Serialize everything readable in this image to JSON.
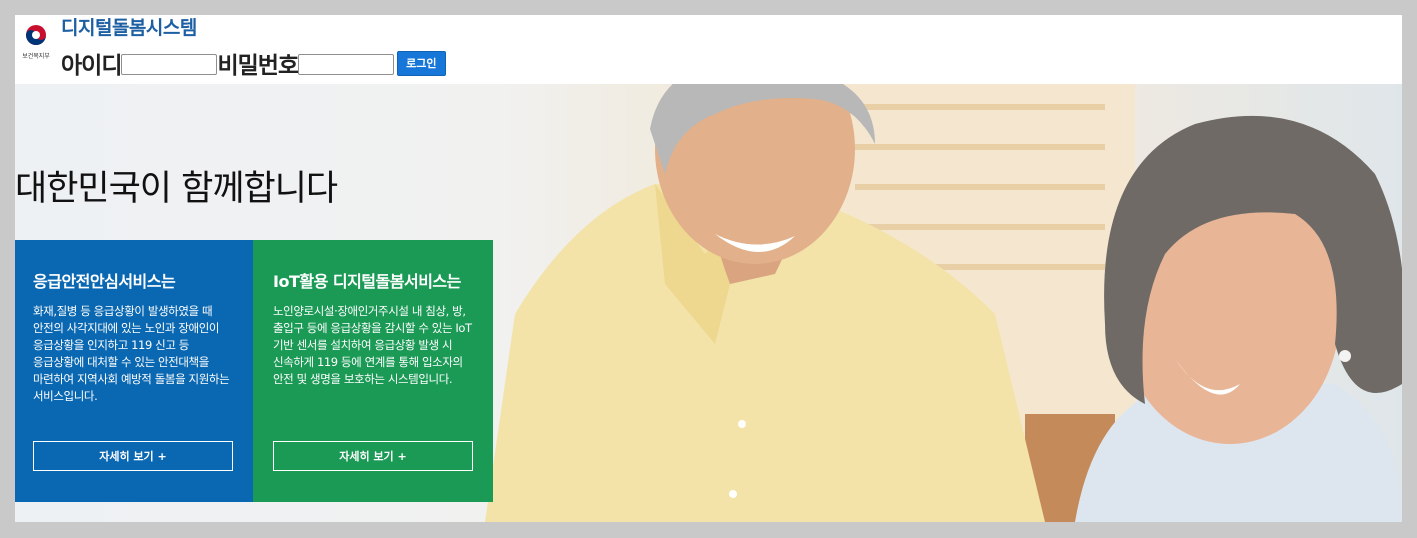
{
  "header": {
    "org_name": "보건복지부",
    "system_title": "디지털돌봄시스템",
    "id_label": "아이디",
    "password_label": "비밀번호",
    "id_value": "",
    "password_value": "",
    "login_button": "로그인"
  },
  "hero": {
    "headline": "대한민국이 함께합니다",
    "cards": [
      {
        "title": "응급안전안심서비스는",
        "body": "화재,질병 등 응급상황이 발생하였을 때 안전의 사각지대에 있는 노인과 장애인이 응급상황을 인지하고 119 신고 등 응급상황에 대처할 수 있는 안전대책을 마련하여 지역사회 예방적 돌봄을 지원하는 서비스입니다.",
        "button": "자세히 보기 +",
        "color": "#0a67b1"
      },
      {
        "title": "IoT활용 디지털돌봄서비스는",
        "body": "노인양로시설·장애인거주시설 내 침상, 방, 출입구 등에 응급상황을 감시할 수 있는 IoT 기반 센서를 설치하여 응급상황 발생 시 신속하게 119 등에 연계를 통해 입소자의 안전 및 생명을 보호하는 시스템입니다.",
        "button": "자세히 보기 +",
        "color": "#1b9a56"
      }
    ]
  },
  "icons": {
    "logo": "korea-government-emblem-icon"
  },
  "colors": {
    "brand_blue": "#1d5fa3",
    "login_button": "#1677d8",
    "card_blue": "#0a67b1",
    "card_green": "#1b9a56"
  }
}
